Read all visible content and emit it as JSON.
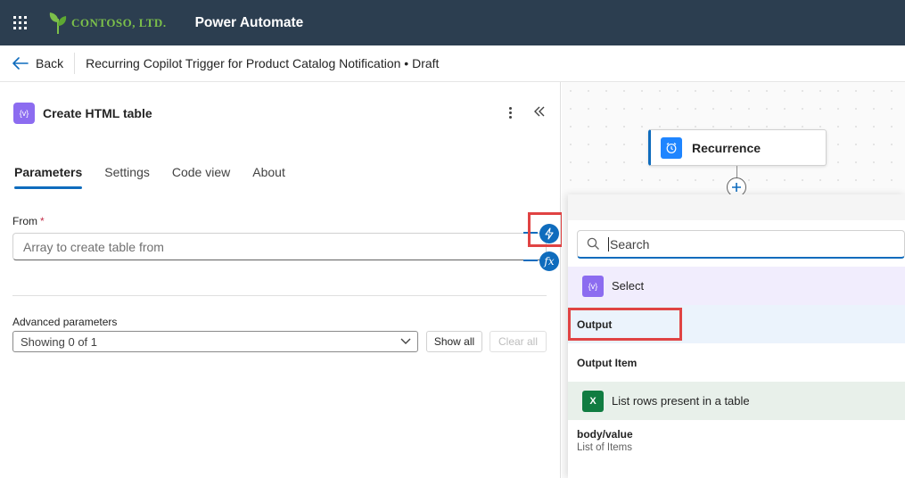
{
  "app": {
    "company": "CONTOSO, LTD.",
    "name": "Power Automate"
  },
  "command_bar": {
    "back_label": "Back",
    "flow_title": "Recurring Copilot Trigger for Product Catalog Notification • Draft"
  },
  "panel": {
    "action_icon_text": "{v}",
    "action_title": "Create HTML table",
    "tabs": [
      {
        "label": "Parameters",
        "active": true
      },
      {
        "label": "Settings",
        "active": false
      },
      {
        "label": "Code view",
        "active": false
      },
      {
        "label": "About",
        "active": false
      }
    ],
    "from_label": "From",
    "from_required": "*",
    "from_placeholder": "Array to create table from",
    "advanced_label": "Advanced parameters",
    "advanced_value": "Showing 0 of 1",
    "show_all_label": "Show all",
    "clear_all_label": "Clear all",
    "fx_label": "fx"
  },
  "canvas": {
    "trigger_node_label": "Recurrence"
  },
  "dynamic_content": {
    "search_placeholder": "Search",
    "groups": [
      {
        "icon_text": "{v}",
        "title": "Select",
        "accent": "#8c6cf0",
        "items": [
          {
            "name": "Output",
            "description": ""
          },
          {
            "name": "Output Item",
            "description": ""
          }
        ]
      },
      {
        "icon_text": "X",
        "title": "List rows present in a table",
        "accent": "#107c41",
        "items": [
          {
            "name": "body/value",
            "description": "List of Items"
          }
        ]
      }
    ]
  },
  "colors": {
    "header_bg": "#2c3e50",
    "brand_green": "#7cc04a",
    "accent_blue": "#0f6cbd",
    "highlight_red": "#e04343"
  }
}
